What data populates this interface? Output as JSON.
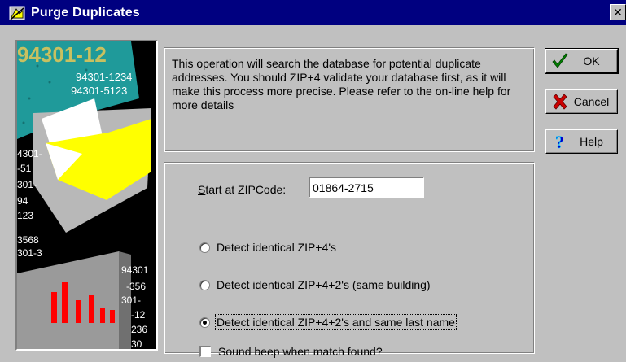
{
  "window": {
    "title": "Purge Duplicates",
    "close_glyph": "✕"
  },
  "picture": {
    "alt": "decorative ZIP code collage",
    "numbers": [
      "94301-12",
      "94301-1234",
      "94301-5123",
      "4301-",
      "-51",
      "301-",
      "94",
      "123",
      "3568",
      "301-3",
      "94301",
      "-356",
      "301-",
      "-12",
      "236",
      "30"
    ]
  },
  "info": {
    "text": "This operation will search the database for potential duplicate addresses.  You should ZIP+4 validate your database first, as it will make this process more precise.  Please refer to the on-line help for more details"
  },
  "options": {
    "start_zip_label": "Start at ZIPCode:",
    "start_zip_value": "01864-2715",
    "radios": [
      {
        "label": "Detect identical ZIP+4's",
        "checked": false
      },
      {
        "label": "Detect identical ZIP+4+2's (same building)",
        "checked": false
      },
      {
        "label": "Detect identical ZIP+4+2's and same last name",
        "checked": true
      }
    ],
    "beep_label": "Sound beep when match found?",
    "beep_checked": false
  },
  "buttons": {
    "ok": "OK",
    "cancel": "Cancel",
    "help": "Help"
  },
  "icons": {
    "title": "app-icon",
    "ok": "checkmark-icon",
    "cancel": "red-x-icon",
    "help": "question-mark-icon"
  },
  "colors": {
    "title_bar": "#000080",
    "face": "#c0c0c0",
    "ok_check": "#008000",
    "cancel_x": "#cc0000",
    "help_q": "#0000cc"
  }
}
